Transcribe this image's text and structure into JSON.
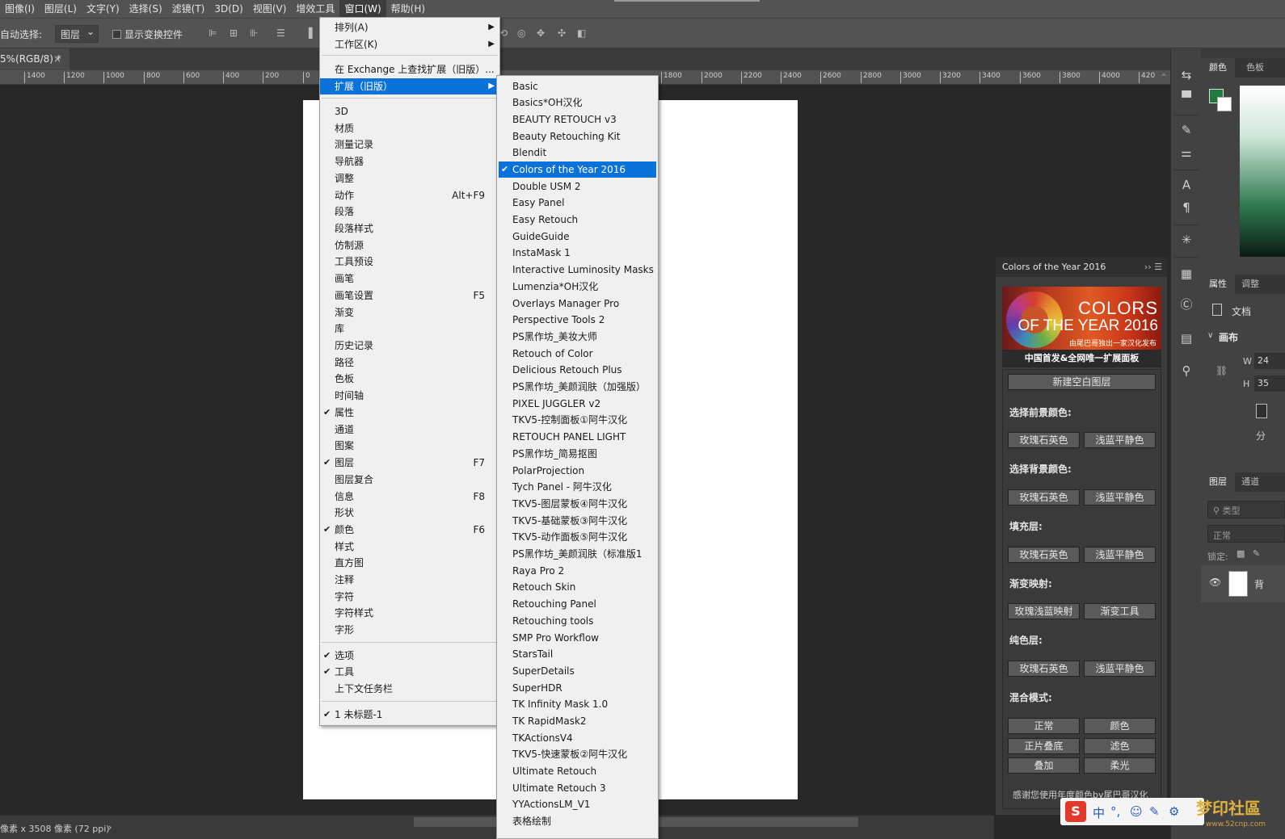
{
  "menubar": {
    "items": [
      "图像(I)",
      "图层(L)",
      "文字(Y)",
      "选择(S)",
      "滤镜(T)",
      "3D(D)",
      "视图(V)",
      "增效工具",
      "窗口(W)",
      "帮助(H)"
    ]
  },
  "options": {
    "auto_select_label": "自动选择:",
    "auto_select_value": "图层",
    "show_transform_label": "显示变换控件"
  },
  "doc_tab": {
    "title": "5%(RGB/8) *",
    "close": "×"
  },
  "ruler": {
    "ticks": [
      "1400",
      "1200",
      "1000",
      "800",
      "600",
      "400",
      "200",
      "0",
      "1800",
      "2000",
      "2200",
      "2400",
      "2600",
      "2800",
      "3000",
      "3200",
      "3400",
      "3600",
      "3800",
      "4000",
      "420"
    ]
  },
  "status": {
    "text": "像素 x 3508 像素 (72 ppi)",
    "nav": "›"
  },
  "window_menu": {
    "items": [
      {
        "label": "排列(A)",
        "arrow": "▶"
      },
      {
        "label": "工作区(K)",
        "arrow": "▶"
      },
      {
        "label": "在 Exchange 上查找扩展（旧版）..."
      },
      {
        "label": "扩展（旧版）",
        "arrow": "▶"
      },
      {
        "label": "3D"
      },
      {
        "label": "材质"
      },
      {
        "label": "测量记录"
      },
      {
        "label": "导航器"
      },
      {
        "label": "调整"
      },
      {
        "label": "动作",
        "shortcut": "Alt+F9"
      },
      {
        "label": "段落"
      },
      {
        "label": "段落样式"
      },
      {
        "label": "仿制源"
      },
      {
        "label": "工具预设"
      },
      {
        "label": "画笔"
      },
      {
        "label": "画笔设置",
        "shortcut": "F5"
      },
      {
        "label": "渐变"
      },
      {
        "label": "库"
      },
      {
        "label": "历史记录"
      },
      {
        "label": "路径"
      },
      {
        "label": "色板"
      },
      {
        "label": "时间轴"
      },
      {
        "label": "属性",
        "check": "✔"
      },
      {
        "label": "通道"
      },
      {
        "label": "图案"
      },
      {
        "label": "图层",
        "check": "✔",
        "shortcut": "F7"
      },
      {
        "label": "图层复合"
      },
      {
        "label": "信息",
        "shortcut": "F8"
      },
      {
        "label": "形状"
      },
      {
        "label": "颜色",
        "check": "✔",
        "shortcut": "F6"
      },
      {
        "label": "样式"
      },
      {
        "label": "直方图"
      },
      {
        "label": "注释"
      },
      {
        "label": "字符"
      },
      {
        "label": "字符样式"
      },
      {
        "label": "字形"
      },
      {
        "label": "选项",
        "check": "✔"
      },
      {
        "label": "工具",
        "check": "✔"
      },
      {
        "label": "上下文任务栏"
      },
      {
        "label": "1 未标题-1",
        "check": "✔"
      }
    ]
  },
  "extensions_menu": {
    "items": [
      "Basic",
      "Basics*OH汉化",
      "BEAUTY RETOUCH v3",
      "Beauty Retouching Kit",
      "Blendit",
      "Colors of the Year 2016",
      "Double USM 2",
      "Easy Panel",
      "Easy Retouch",
      "GuideGuide",
      "InstaMask 1",
      "Interactive Luminosity Masks",
      "Lumenzia*OH汉化",
      "Overlays Manager Pro",
      "Perspective Tools 2",
      "PS黑作坊_美妆大师",
      "Retouch of Color",
      "Delicious Retouch Plus",
      "PS黑作坊_美颜润肤（加强版）",
      "PIXEL JUGGLER v2",
      "TKV5-控制面板①阿牛汉化",
      "RETOUCH PANEL LIGHT",
      "PS黑作坊_简易抠图",
      "PolarProjection",
      "Tych Panel - 阿牛汉化",
      "TKV5-图层蒙板④阿牛汉化",
      "TKV5-基础蒙板③阿牛汉化",
      "TKV5-动作面板⑤阿牛汉化",
      "PS黑作坊_美颜润肤（标准版1",
      "Raya Pro 2",
      "Retouch Skin",
      "Retouching Panel",
      "Retouching tools",
      "SMP Pro Workflow",
      "StarsTail",
      "SuperDetails",
      "SuperHDR",
      "TK Infinity Mask 1.0",
      "TK RapidMask2",
      "TKActionsV4",
      "TKV5-快速蒙板②阿牛汉化",
      "Ultimate Retouch",
      "Ultimate Retouch 3",
      "YYActionsLM_V1",
      "表格绘制"
    ],
    "checked": "✔"
  },
  "right_panels": {
    "color_tabs": [
      "颜色",
      "色板"
    ],
    "props_tabs": [
      "属性",
      "调整"
    ],
    "doc_label": "文档",
    "canvas_label": "画布",
    "w_label": "W",
    "w_value": "24",
    "h_label": "H",
    "h_value": "35",
    "split_label": "分",
    "layers_tabs": [
      "图层",
      "通道"
    ],
    "search_placeholder": "类型",
    "blend_mode": "正常",
    "lock_label": "锁定:",
    "layer_name": "背",
    "collapse": "‹‹"
  },
  "cot_panel": {
    "title": "Colors of the Year 2016",
    "controls": "››  ☰",
    "banner_line1": "COLORS",
    "banner_line2": "OF THE YEAR 2016",
    "banner_line3": "由尾巴哥独出一家汉化发布",
    "banner_line4": "中国首发&全网唯一扩展面板",
    "new_layer": "新建空白图层",
    "sec_fg": "选择前景颜色:",
    "sec_bg": "选择背景颜色:",
    "sec_fill": "填充层:",
    "sec_grad": "渐变映射:",
    "sec_solid": "纯色层:",
    "sec_blend": "混合模式:",
    "rose": "玫瑰石英色",
    "serenity": "浅蓝平静色",
    "grad_map": "玫瑰浅蓝映射",
    "grad_tool": "渐变工具",
    "normal": "正常",
    "color": "颜色",
    "multiply": "正片叠底",
    "screen": "滤色",
    "overlay": "叠加",
    "softlight": "柔光",
    "footer": "感谢您使用年度颜色by尾巴哥汉化"
  },
  "ime": {
    "s": "S",
    "icons": [
      "中",
      "°,",
      "☺",
      "✎",
      "⚙"
    ]
  },
  "watermark": {
    "main": "梦印社區",
    "url": "www.52cnp.com"
  },
  "colors": {
    "menu_highlight": "#0a72d9",
    "fg_swatch": "#1f7a3e"
  }
}
